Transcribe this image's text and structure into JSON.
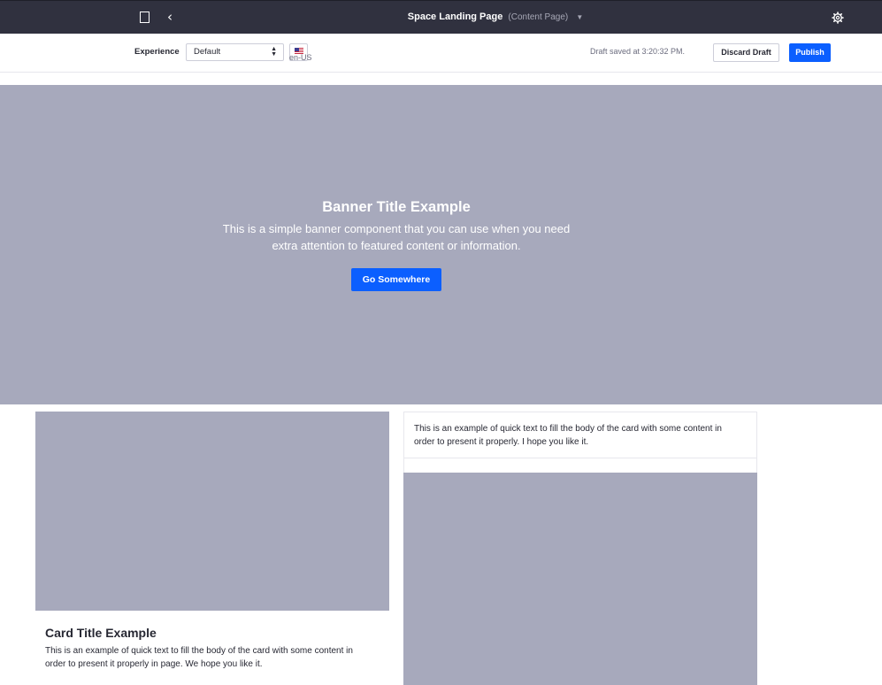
{
  "topbar": {
    "title": "Space Landing Page",
    "page_type": "(Content Page)",
    "icons": [
      "page-icon",
      "back-icon",
      "caret-down-icon",
      "gear-icon"
    ]
  },
  "toolbar": {
    "experience_label": "Experience",
    "experience_value": "Default",
    "language": "en-US",
    "draft_status": "Draft saved at 3:20:32 PM.",
    "discard_label": "Discard Draft",
    "publish_label": "Publish"
  },
  "banner": {
    "title": "Banner Title Example",
    "text": "This is a simple banner component that you can use when you need extra attention to featured content or information.",
    "button_label": "Go Somewhere"
  },
  "cards": [
    {
      "title": "Card Title Example",
      "text": "This is an example of quick text to fill the body of the card with some content in order to present it properly in page. We hope you like it."
    },
    {
      "text": "This is an example of quick text to fill the body of the card with some content in order to present it properly. I hope you like it."
    }
  ],
  "colors": {
    "topbar": "#30313f",
    "accent": "#0b5fff",
    "placeholder": "#a7a9bc"
  }
}
